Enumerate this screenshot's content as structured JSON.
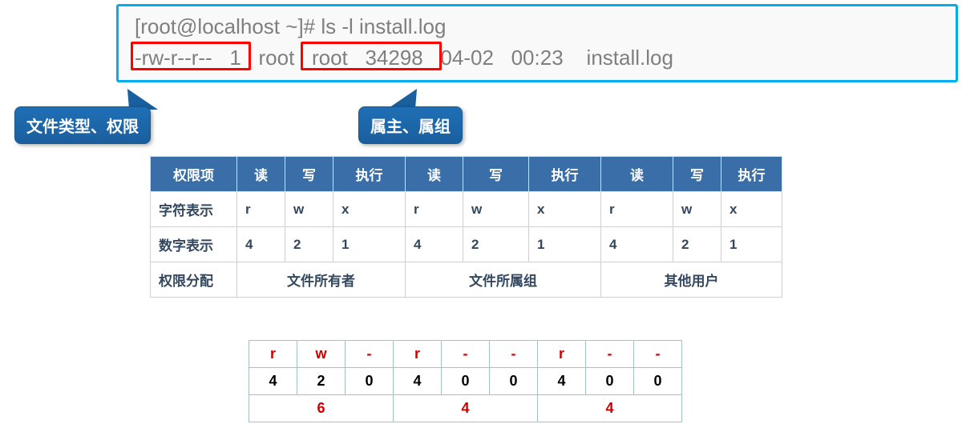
{
  "terminal": {
    "line1": "[root@localhost ~]# ls -l install.log",
    "line2": "-rw-r--r--   1   root   root   34298   04-02   00:23    install.log"
  },
  "callout1": "文件类型、权限",
  "callout2": "属主、属组",
  "table1": {
    "header": [
      "权限项",
      "读",
      "写",
      "执行",
      "读",
      "写",
      "执行",
      "读",
      "写",
      "执行"
    ],
    "row_char_label": "字符表示",
    "row_char": [
      "r",
      "w",
      "x",
      "r",
      "w",
      "x",
      "r",
      "w",
      "x"
    ],
    "row_num_label": "数字表示",
    "row_num": [
      "4",
      "2",
      "1",
      "4",
      "2",
      "1",
      "4",
      "2",
      "1"
    ],
    "row_group_label": "权限分配",
    "groups": [
      "文件所有者",
      "文件所属组",
      "其他用户"
    ]
  },
  "table2": {
    "symbols": [
      "r",
      "w",
      "-",
      "r",
      "-",
      "-",
      "r",
      "-",
      "-"
    ],
    "numbers": [
      "4",
      "2",
      "0",
      "4",
      "0",
      "0",
      "4",
      "0",
      "0"
    ],
    "sums": [
      "6",
      "4",
      "4"
    ]
  }
}
